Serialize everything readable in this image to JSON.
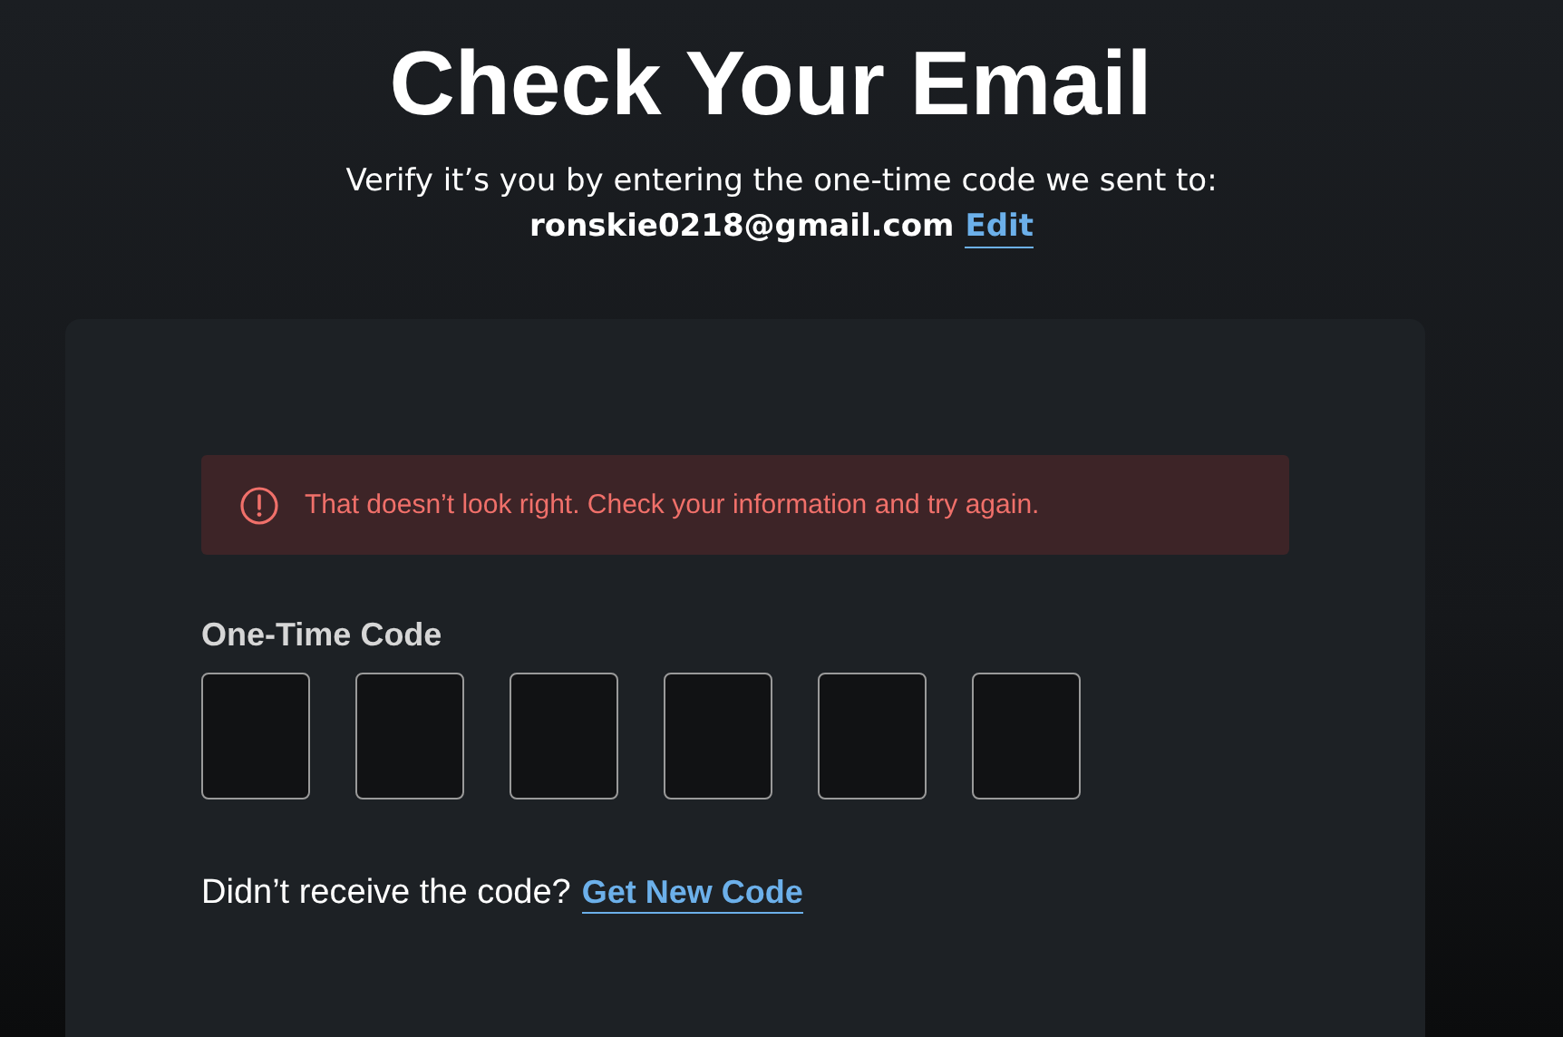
{
  "title": "Check Your Email",
  "subtitle": "Verify it’s you by entering the one-time code we sent to:",
  "email": "ronskie0218@gmail.com",
  "edit_link": "Edit",
  "card": {
    "error": {
      "kind": "error",
      "message": "That doesn’t look right. Check your information and try again."
    },
    "code_label": "One-Time Code",
    "code_boxes": [
      {
        "kind": "digit"
      },
      {
        "kind": "digit"
      },
      {
        "kind": "digit"
      },
      {
        "kind": "digit"
      },
      {
        "kind": "digit"
      },
      {
        "kind": "digit"
      }
    ],
    "resend_prompt": "Didn’t receive the code?",
    "resend_link": "Get New Code"
  }
}
